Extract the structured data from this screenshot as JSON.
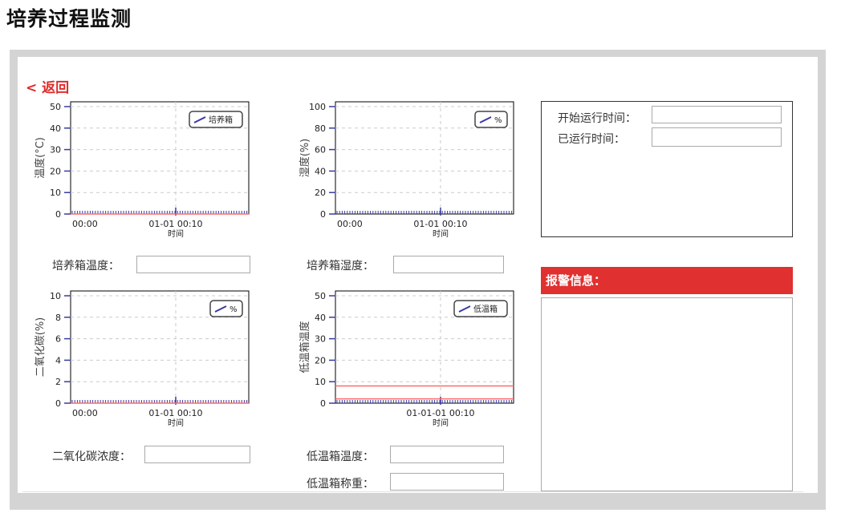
{
  "page": {
    "title": "培养过程监测",
    "back_label": "< 返回"
  },
  "charts": [
    {
      "id": "incubator-temp",
      "ylabel": "温度(°C)",
      "yticks": [
        "50",
        "40",
        "30",
        "20",
        "10",
        "0"
      ],
      "xticks": [
        "00:00",
        "01-01 00:10"
      ],
      "xlabel": "时间",
      "legend": "培养箱",
      "line_color": "#ff6b6b",
      "chart_data": {
        "type": "line",
        "ylim": [
          0,
          50
        ],
        "series": [
          {
            "name": "培养箱",
            "values": [
              0
            ]
          }
        ]
      }
    },
    {
      "id": "humidity",
      "ylabel": "湿度(%)",
      "yticks": [
        "100",
        "80",
        "60",
        "40",
        "20",
        "0"
      ],
      "xticks": [
        "00:00",
        "01-01 00:10"
      ],
      "xlabel": "时间",
      "legend": "%",
      "chart_data": {
        "type": "line",
        "ylim": [
          0,
          100
        ],
        "series": [
          {
            "name": "%",
            "values": []
          }
        ]
      }
    },
    {
      "id": "co2",
      "ylabel": "二氧化碳(%)",
      "yticks": [
        "10",
        "8",
        "6",
        "4",
        "2",
        "0"
      ],
      "xticks": [
        "00:00",
        "01-01 00:10"
      ],
      "xlabel": "时间",
      "legend": "%",
      "line_color": "#ff6b6b",
      "chart_data": {
        "type": "line",
        "ylim": [
          0,
          10
        ],
        "series": [
          {
            "name": "%",
            "values": [
              0
            ]
          }
        ]
      }
    },
    {
      "id": "low-temp",
      "ylabel": "低温箱温度",
      "yticks": [
        "50",
        "40",
        "30",
        "20",
        "10",
        "0"
      ],
      "xticks": [
        "01-01-01 00:10"
      ],
      "xlabel": "时间",
      "legend": "低温箱",
      "line_color": "#ff6b6b",
      "chart_data": {
        "type": "line",
        "ylim": [
          0,
          50
        ],
        "series": [
          {
            "name": "低温箱",
            "values": [
              8
            ]
          },
          {
            "name": "",
            "values": [
              2
            ]
          }
        ]
      }
    }
  ],
  "fields": {
    "incubator_temp_1": {
      "label": "培养箱温度：",
      "value": ""
    },
    "incubator_temp_2": {
      "label": "培养箱湿度：",
      "value": ""
    },
    "co2_concentration": {
      "label": "二氧化碳浓度：",
      "value": ""
    },
    "low_temp_box_temp": {
      "label": "低温箱温度：",
      "value": ""
    },
    "low_temp_box_weight": {
      "label": "低温箱称重：",
      "value": ""
    }
  },
  "status": {
    "start_time_label": "开始运行时间：",
    "start_time_value": "",
    "elapsed_label": "已运行时间：",
    "elapsed_value": ""
  },
  "alarm": {
    "header": "报警信息：",
    "messages": []
  },
  "colors": {
    "accent_red": "#e03030",
    "back_link": "#e02a2a",
    "series_blue": "#3a3aa0",
    "data_line": "#ff6b6b"
  }
}
